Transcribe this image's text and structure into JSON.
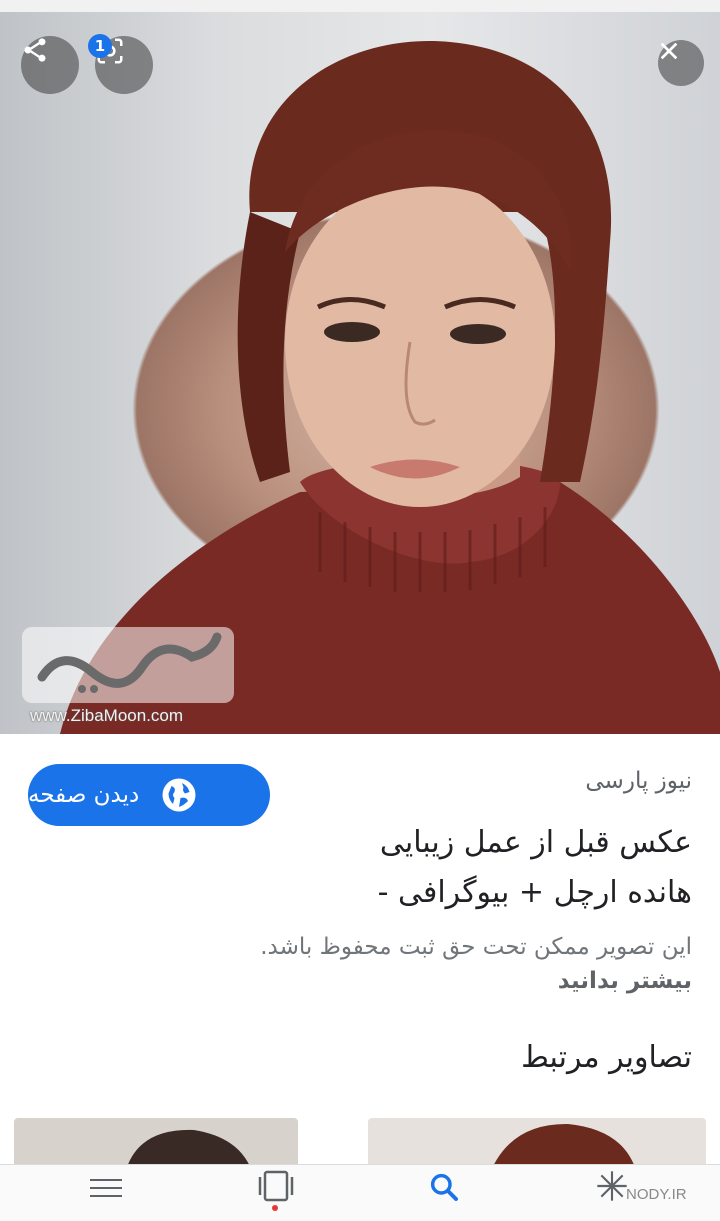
{
  "viewer": {
    "badge_count": "1",
    "watermark_url": "www.ZibaMoon.com",
    "watermark_logo": "زیبامون"
  },
  "result": {
    "source": "نیوز پارسی",
    "visit_label": "دیدن صفحه",
    "title_line1": "عکس قبل از عمل زیبایی",
    "title_line2": "هانده ارچل + بیوگرافی -",
    "notice": "این تصویر ممکن تحت حق ثبت محفوظ باشد.",
    "learn_more": "بیشتر بدانید",
    "related_heading": "تصاویر مرتبط"
  },
  "bottom_nav": {
    "items": [
      "menu-icon",
      "tabs-icon",
      "search-icon",
      "discover-icon"
    ],
    "watermark": "NODY.IR"
  },
  "colors": {
    "accent": "#1a73e8",
    "sweater": "#7a2a25",
    "hair": "#6b2a1e"
  }
}
